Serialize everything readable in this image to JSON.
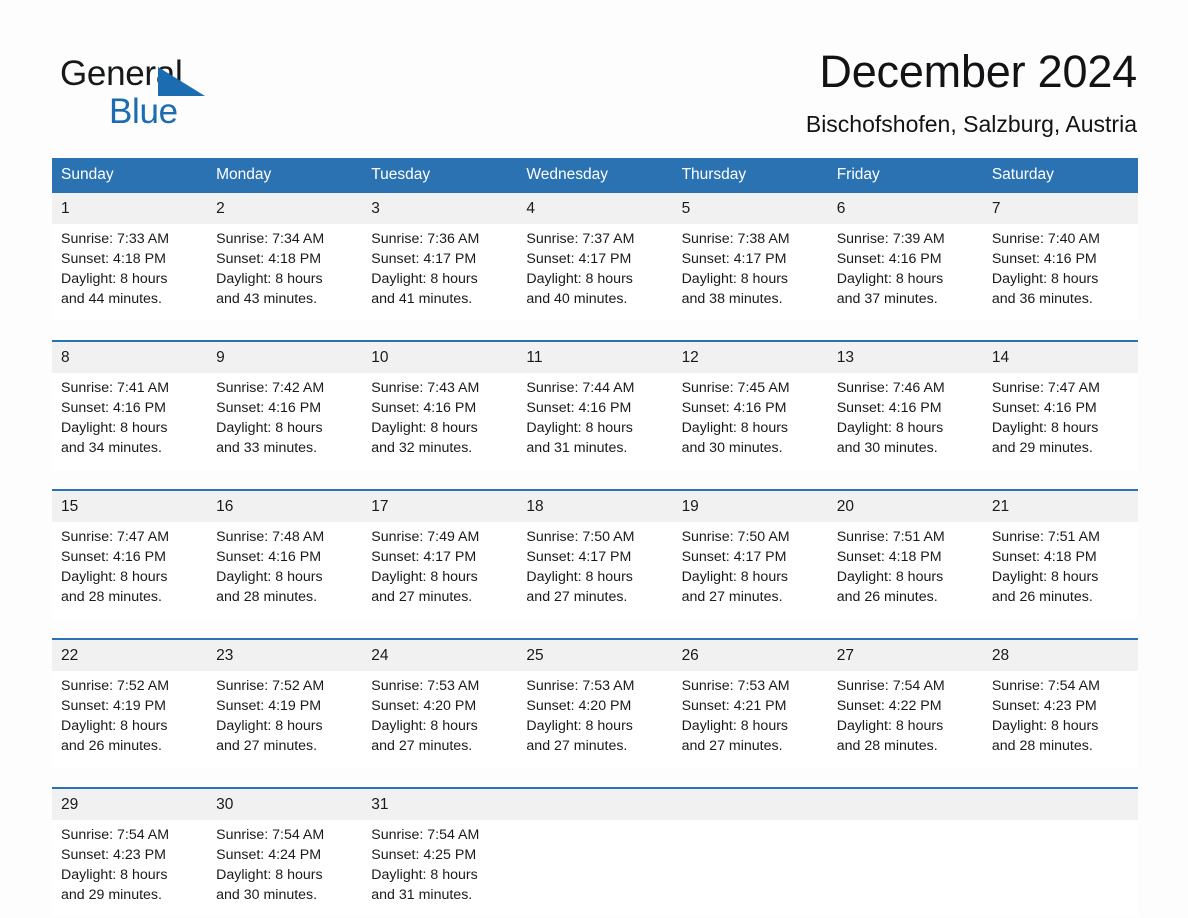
{
  "brand": {
    "name_part1": "General",
    "name_part2": "Blue",
    "triangle_color": "#1b6cb0",
    "icon": "brand-triangle-icon"
  },
  "header": {
    "title": "December 2024",
    "subtitle": "Bischofshofen, Salzburg, Austria"
  },
  "theme": {
    "header_blue": "#2b72b3",
    "daynum_band": "#f1f1f1",
    "page_background": "#fdfdfd",
    "text": "#1a1a1a"
  },
  "weekday_headers": [
    "Sunday",
    "Monday",
    "Tuesday",
    "Wednesday",
    "Thursday",
    "Friday",
    "Saturday"
  ],
  "weeks": [
    {
      "days": [
        {
          "date": "1",
          "sunrise": "Sunrise: 7:33 AM",
          "sunset": "Sunset: 4:18 PM",
          "daylight_line1": "Daylight: 8 hours",
          "daylight_line2": "and 44 minutes."
        },
        {
          "date": "2",
          "sunrise": "Sunrise: 7:34 AM",
          "sunset": "Sunset: 4:18 PM",
          "daylight_line1": "Daylight: 8 hours",
          "daylight_line2": "and 43 minutes."
        },
        {
          "date": "3",
          "sunrise": "Sunrise: 7:36 AM",
          "sunset": "Sunset: 4:17 PM",
          "daylight_line1": "Daylight: 8 hours",
          "daylight_line2": "and 41 minutes."
        },
        {
          "date": "4",
          "sunrise": "Sunrise: 7:37 AM",
          "sunset": "Sunset: 4:17 PM",
          "daylight_line1": "Daylight: 8 hours",
          "daylight_line2": "and 40 minutes."
        },
        {
          "date": "5",
          "sunrise": "Sunrise: 7:38 AM",
          "sunset": "Sunset: 4:17 PM",
          "daylight_line1": "Daylight: 8 hours",
          "daylight_line2": "and 38 minutes."
        },
        {
          "date": "6",
          "sunrise": "Sunrise: 7:39 AM",
          "sunset": "Sunset: 4:16 PM",
          "daylight_line1": "Daylight: 8 hours",
          "daylight_line2": "and 37 minutes."
        },
        {
          "date": "7",
          "sunrise": "Sunrise: 7:40 AM",
          "sunset": "Sunset: 4:16 PM",
          "daylight_line1": "Daylight: 8 hours",
          "daylight_line2": "and 36 minutes."
        }
      ]
    },
    {
      "days": [
        {
          "date": "8",
          "sunrise": "Sunrise: 7:41 AM",
          "sunset": "Sunset: 4:16 PM",
          "daylight_line1": "Daylight: 8 hours",
          "daylight_line2": "and 34 minutes."
        },
        {
          "date": "9",
          "sunrise": "Sunrise: 7:42 AM",
          "sunset": "Sunset: 4:16 PM",
          "daylight_line1": "Daylight: 8 hours",
          "daylight_line2": "and 33 minutes."
        },
        {
          "date": "10",
          "sunrise": "Sunrise: 7:43 AM",
          "sunset": "Sunset: 4:16 PM",
          "daylight_line1": "Daylight: 8 hours",
          "daylight_line2": "and 32 minutes."
        },
        {
          "date": "11",
          "sunrise": "Sunrise: 7:44 AM",
          "sunset": "Sunset: 4:16 PM",
          "daylight_line1": "Daylight: 8 hours",
          "daylight_line2": "and 31 minutes."
        },
        {
          "date": "12",
          "sunrise": "Sunrise: 7:45 AM",
          "sunset": "Sunset: 4:16 PM",
          "daylight_line1": "Daylight: 8 hours",
          "daylight_line2": "and 30 minutes."
        },
        {
          "date": "13",
          "sunrise": "Sunrise: 7:46 AM",
          "sunset": "Sunset: 4:16 PM",
          "daylight_line1": "Daylight: 8 hours",
          "daylight_line2": "and 30 minutes."
        },
        {
          "date": "14",
          "sunrise": "Sunrise: 7:47 AM",
          "sunset": "Sunset: 4:16 PM",
          "daylight_line1": "Daylight: 8 hours",
          "daylight_line2": "and 29 minutes."
        }
      ]
    },
    {
      "days": [
        {
          "date": "15",
          "sunrise": "Sunrise: 7:47 AM",
          "sunset": "Sunset: 4:16 PM",
          "daylight_line1": "Daylight: 8 hours",
          "daylight_line2": "and 28 minutes."
        },
        {
          "date": "16",
          "sunrise": "Sunrise: 7:48 AM",
          "sunset": "Sunset: 4:16 PM",
          "daylight_line1": "Daylight: 8 hours",
          "daylight_line2": "and 28 minutes."
        },
        {
          "date": "17",
          "sunrise": "Sunrise: 7:49 AM",
          "sunset": "Sunset: 4:17 PM",
          "daylight_line1": "Daylight: 8 hours",
          "daylight_line2": "and 27 minutes."
        },
        {
          "date": "18",
          "sunrise": "Sunrise: 7:50 AM",
          "sunset": "Sunset: 4:17 PM",
          "daylight_line1": "Daylight: 8 hours",
          "daylight_line2": "and 27 minutes."
        },
        {
          "date": "19",
          "sunrise": "Sunrise: 7:50 AM",
          "sunset": "Sunset: 4:17 PM",
          "daylight_line1": "Daylight: 8 hours",
          "daylight_line2": "and 27 minutes."
        },
        {
          "date": "20",
          "sunrise": "Sunrise: 7:51 AM",
          "sunset": "Sunset: 4:18 PM",
          "daylight_line1": "Daylight: 8 hours",
          "daylight_line2": "and 26 minutes."
        },
        {
          "date": "21",
          "sunrise": "Sunrise: 7:51 AM",
          "sunset": "Sunset: 4:18 PM",
          "daylight_line1": "Daylight: 8 hours",
          "daylight_line2": "and 26 minutes."
        }
      ]
    },
    {
      "days": [
        {
          "date": "22",
          "sunrise": "Sunrise: 7:52 AM",
          "sunset": "Sunset: 4:19 PM",
          "daylight_line1": "Daylight: 8 hours",
          "daylight_line2": "and 26 minutes."
        },
        {
          "date": "23",
          "sunrise": "Sunrise: 7:52 AM",
          "sunset": "Sunset: 4:19 PM",
          "daylight_line1": "Daylight: 8 hours",
          "daylight_line2": "and 27 minutes."
        },
        {
          "date": "24",
          "sunrise": "Sunrise: 7:53 AM",
          "sunset": "Sunset: 4:20 PM",
          "daylight_line1": "Daylight: 8 hours",
          "daylight_line2": "and 27 minutes."
        },
        {
          "date": "25",
          "sunrise": "Sunrise: 7:53 AM",
          "sunset": "Sunset: 4:20 PM",
          "daylight_line1": "Daylight: 8 hours",
          "daylight_line2": "and 27 minutes."
        },
        {
          "date": "26",
          "sunrise": "Sunrise: 7:53 AM",
          "sunset": "Sunset: 4:21 PM",
          "daylight_line1": "Daylight: 8 hours",
          "daylight_line2": "and 27 minutes."
        },
        {
          "date": "27",
          "sunrise": "Sunrise: 7:54 AM",
          "sunset": "Sunset: 4:22 PM",
          "daylight_line1": "Daylight: 8 hours",
          "daylight_line2": "and 28 minutes."
        },
        {
          "date": "28",
          "sunrise": "Sunrise: 7:54 AM",
          "sunset": "Sunset: 4:23 PM",
          "daylight_line1": "Daylight: 8 hours",
          "daylight_line2": "and 28 minutes."
        }
      ]
    },
    {
      "days": [
        {
          "date": "29",
          "sunrise": "Sunrise: 7:54 AM",
          "sunset": "Sunset: 4:23 PM",
          "daylight_line1": "Daylight: 8 hours",
          "daylight_line2": "and 29 minutes."
        },
        {
          "date": "30",
          "sunrise": "Sunrise: 7:54 AM",
          "sunset": "Sunset: 4:24 PM",
          "daylight_line1": "Daylight: 8 hours",
          "daylight_line2": "and 30 minutes."
        },
        {
          "date": "31",
          "sunrise": "Sunrise: 7:54 AM",
          "sunset": "Sunset: 4:25 PM",
          "daylight_line1": "Daylight: 8 hours",
          "daylight_line2": "and 31 minutes."
        },
        {
          "date": "",
          "sunrise": "",
          "sunset": "",
          "daylight_line1": "",
          "daylight_line2": ""
        },
        {
          "date": "",
          "sunrise": "",
          "sunset": "",
          "daylight_line1": "",
          "daylight_line2": ""
        },
        {
          "date": "",
          "sunrise": "",
          "sunset": "",
          "daylight_line1": "",
          "daylight_line2": ""
        },
        {
          "date": "",
          "sunrise": "",
          "sunset": "",
          "daylight_line1": "",
          "daylight_line2": ""
        }
      ]
    }
  ]
}
